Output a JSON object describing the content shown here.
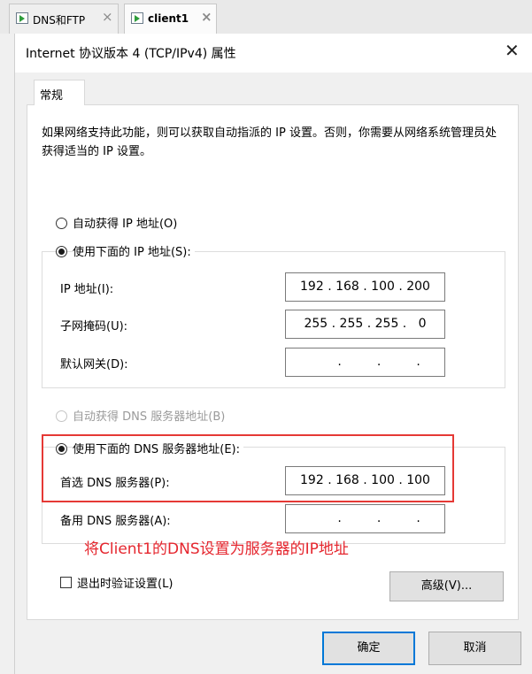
{
  "app_tabs": [
    {
      "label": "DNS和FTP",
      "close": "×"
    },
    {
      "label": "client1",
      "close": "×"
    }
  ],
  "dialog": {
    "title": "Internet 协议版本 4 (TCP/IPv4) 属性",
    "close_glyph": "✕",
    "tab_label": "常规",
    "intro_text": "如果网络支持此功能，则可以获取自动指派的 IP 设置。否则，你需要从网络系统管理员处获得适当的 IP 设置。",
    "ip": {
      "auto_option": "自动获得 IP 地址(O)",
      "manual_option": "使用下面的 IP 地址(S):",
      "selected": "manual",
      "fields": [
        {
          "label": "IP 地址(I):",
          "value": "192 . 168 . 100 . 200"
        },
        {
          "label": "子网掩码(U):",
          "value": "255 . 255 . 255 .   0"
        },
        {
          "label": "默认网关(D):",
          "value": "       .         .         ."
        }
      ]
    },
    "dns": {
      "auto_option": "自动获得 DNS 服务器地址(B)",
      "auto_disabled": true,
      "manual_option": "使用下面的 DNS 服务器地址(E):",
      "selected": "manual",
      "fields": [
        {
          "label": "首选 DNS 服务器(P):",
          "value": "192 . 168 . 100 . 100"
        },
        {
          "label": "备用 DNS 服务器(A):",
          "value": "       .         .         ."
        }
      ]
    },
    "validate_label": "退出时验证设置(L)",
    "validate_checked": false,
    "advanced_button": "高级(V)...",
    "ok_button": "确定",
    "cancel_button": "取消"
  },
  "annotation": {
    "text": "将Client1的DNS设置为服务器的IP地址",
    "color": "#e5262e"
  }
}
